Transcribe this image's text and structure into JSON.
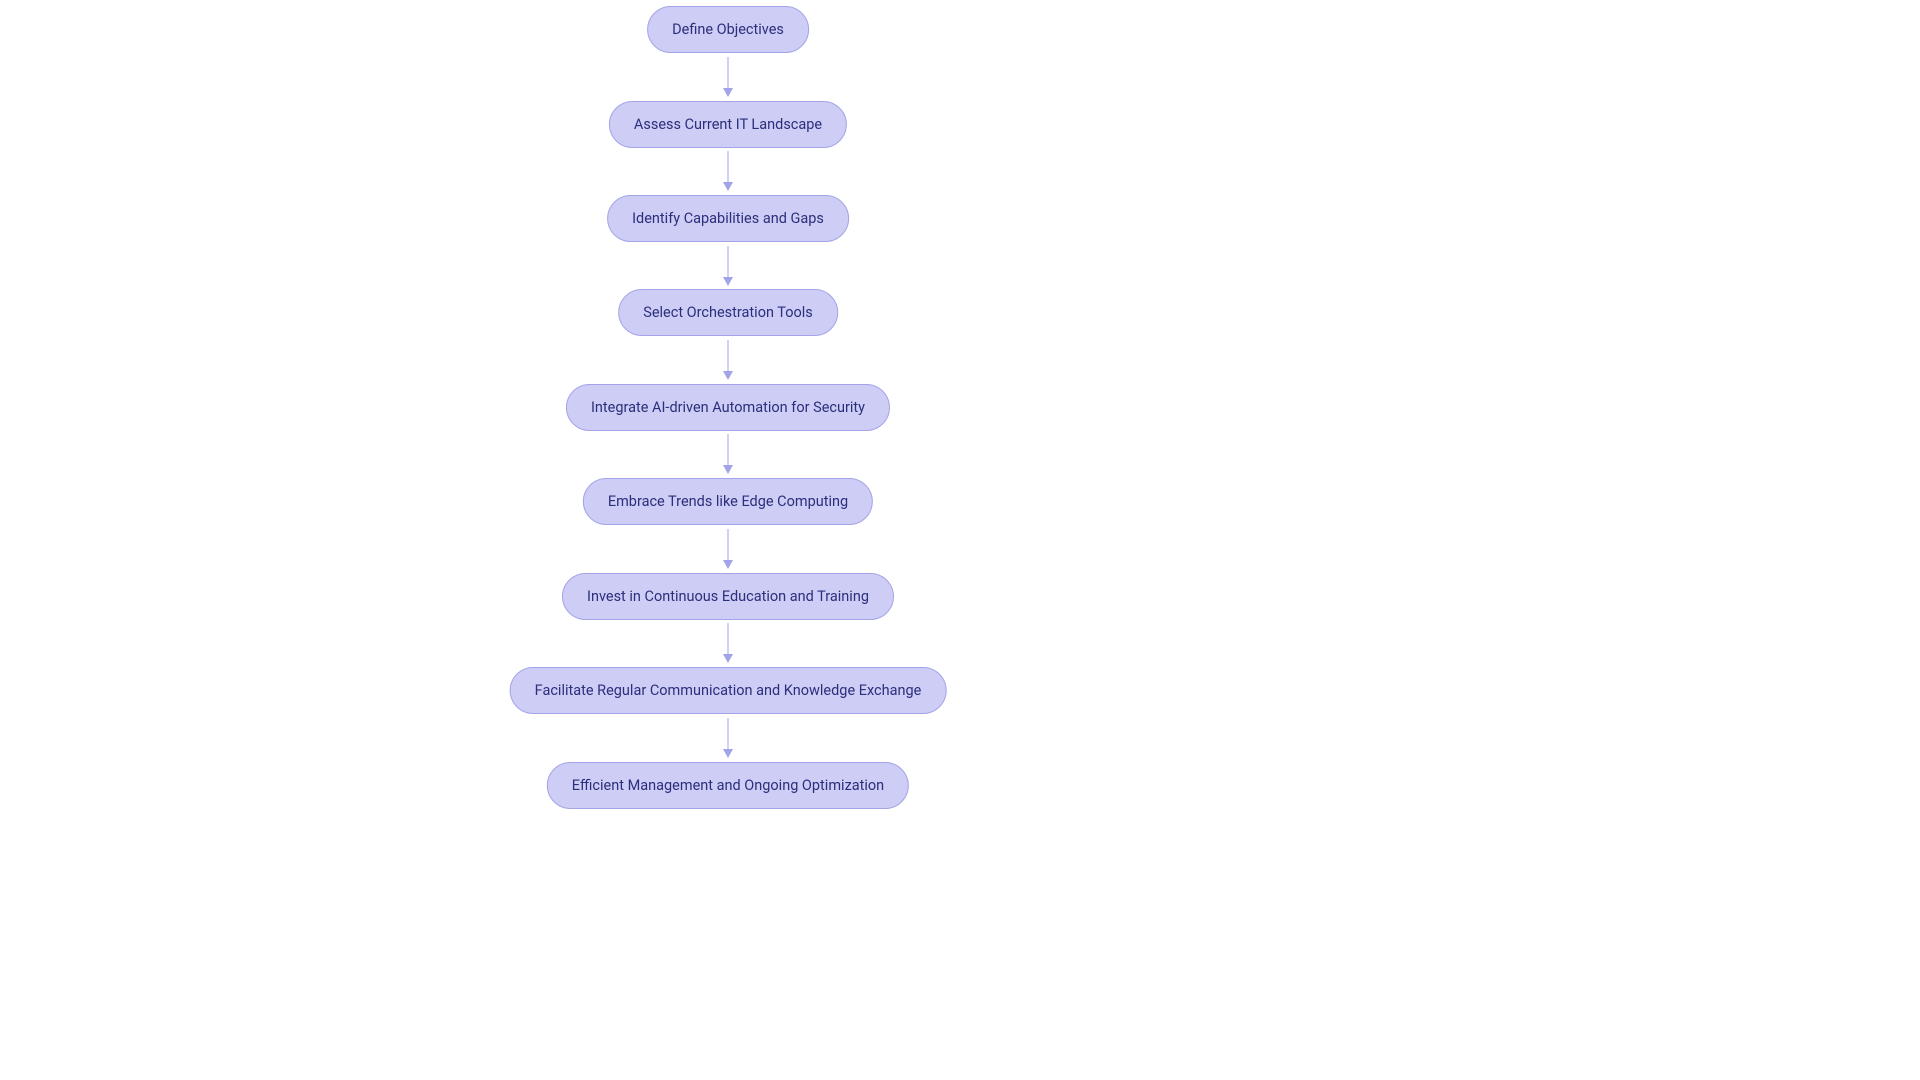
{
  "chart_data": {
    "type": "flowchart",
    "direction": "top-to-bottom",
    "nodes": [
      {
        "id": "n1",
        "label": "Define Objectives"
      },
      {
        "id": "n2",
        "label": "Assess Current IT Landscape"
      },
      {
        "id": "n3",
        "label": "Identify Capabilities and Gaps"
      },
      {
        "id": "n4",
        "label": "Select Orchestration Tools"
      },
      {
        "id": "n5",
        "label": "Integrate AI-driven Automation for Security"
      },
      {
        "id": "n6",
        "label": "Embrace Trends like Edge Computing"
      },
      {
        "id": "n7",
        "label": "Invest in Continuous Education and Training"
      },
      {
        "id": "n8",
        "label": "Facilitate Regular Communication and Knowledge Exchange"
      },
      {
        "id": "n9",
        "label": "Efficient Management and Ongoing Optimization"
      }
    ],
    "edges": [
      {
        "from": "n1",
        "to": "n2"
      },
      {
        "from": "n2",
        "to": "n3"
      },
      {
        "from": "n3",
        "to": "n4"
      },
      {
        "from": "n4",
        "to": "n5"
      },
      {
        "from": "n5",
        "to": "n6"
      },
      {
        "from": "n6",
        "to": "n7"
      },
      {
        "from": "n7",
        "to": "n8"
      },
      {
        "from": "n8",
        "to": "n9"
      }
    ],
    "style": {
      "node_fill": "#cdcdf5",
      "node_border": "#a3a3e8",
      "text_color": "#2b2f7c",
      "arrow_color": "#a3a3e8"
    }
  },
  "layout": {
    "centerX": 728,
    "nodeTops": [
      6,
      101,
      195,
      289,
      384,
      478,
      573,
      667,
      762
    ],
    "arrowTops": [
      57,
      151,
      246,
      340,
      434,
      529,
      623,
      718
    ],
    "arrowHeadTops": [
      88,
      182,
      277,
      371,
      465,
      560,
      654,
      749
    ],
    "shaftHeight": 31
  }
}
